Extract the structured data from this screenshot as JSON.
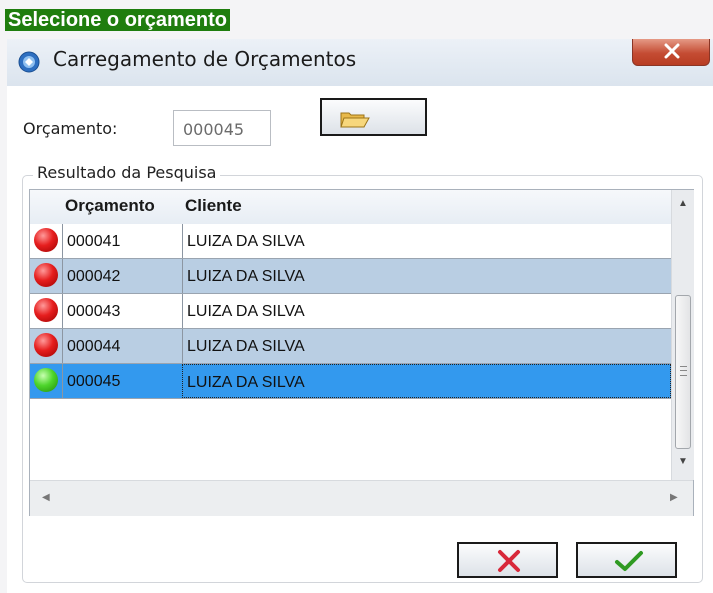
{
  "caption": "Selecione o orçamento",
  "window": {
    "title": "Carregamento de Orçamentos",
    "icon": "app-icon",
    "close_icon": "close-icon"
  },
  "form": {
    "orcamento_label": "Orçamento:",
    "orcamento_value": "000045",
    "browse_icon": "folder-icon"
  },
  "results": {
    "group_title": "Resultado da Pesquisa",
    "columns": [
      "Orçamento",
      "Cliente"
    ],
    "rows": [
      {
        "status": "red",
        "orcamento": "000041",
        "cliente": "LUIZA DA SILVA"
      },
      {
        "status": "red",
        "orcamento": "000042",
        "cliente": "LUIZA DA SILVA"
      },
      {
        "status": "red",
        "orcamento": "000043",
        "cliente": "LUIZA DA SILVA"
      },
      {
        "status": "red",
        "orcamento": "000044",
        "cliente": "LUIZA DA SILVA"
      },
      {
        "status": "green",
        "orcamento": "000045",
        "cliente": "LUIZA DA SILVA",
        "selected": true
      }
    ]
  },
  "buttons": {
    "cancel_icon": "cancel-x-icon",
    "confirm_icon": "confirm-check-icon"
  },
  "colors": {
    "caption_bg": "#1f7d0e",
    "row_alt": "#b9cee3",
    "row_selected": "#3399ee",
    "status_red": "#e61e1e",
    "status_green": "#4ed52c"
  }
}
